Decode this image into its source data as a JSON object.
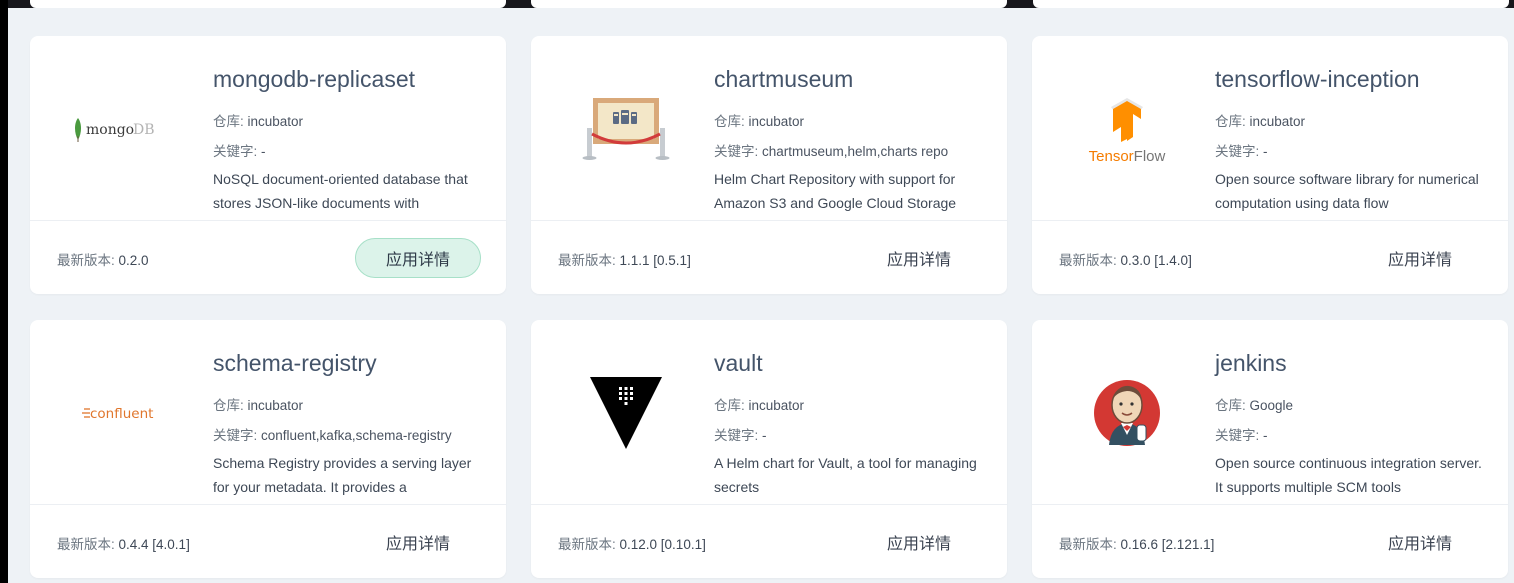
{
  "labels": {
    "repo": "仓库: ",
    "keywords": "关键字: ",
    "latest_version": "最新版本: ",
    "detail_button": "应用详情"
  },
  "cards": [
    {
      "title": "mongodb-replicaset",
      "repo": "incubator",
      "keywords": "-",
      "description": "NoSQL document-oriented database that stores JSON-like documents with",
      "version": "0.2.0",
      "logo": "mongodb-logo",
      "logo_text": "mongoDB",
      "button_active": true
    },
    {
      "title": "chartmuseum",
      "repo": "incubator",
      "keywords": "chartmuseum,helm,charts repo",
      "description": "Helm Chart Repository with support for Amazon S3 and Google Cloud Storage",
      "version": "1.1.1 [0.5.1]",
      "logo": "chartmuseum-logo",
      "button_active": false
    },
    {
      "title": "tensorflow-inception",
      "repo": "incubator",
      "keywords": "-",
      "description": "Open source software library for numerical computation using data flow",
      "version": "0.3.0 [1.4.0]",
      "logo": "tensorflow-logo",
      "logo_text": "TensorFlow",
      "button_active": false
    },
    {
      "title": "schema-registry",
      "repo": "incubator",
      "keywords": "confluent,kafka,schema-registry",
      "description": "Schema Registry provides a serving layer for your metadata. It provides a",
      "version": "0.4.4 [4.0.1]",
      "logo": "confluent-logo",
      "logo_text": "confluent",
      "button_active": false
    },
    {
      "title": "vault",
      "repo": "incubator",
      "keywords": "-",
      "description": "A Helm chart for Vault, a tool for managing secrets",
      "version": "0.12.0 [0.10.1]",
      "logo": "vault-logo",
      "button_active": false
    },
    {
      "title": "jenkins",
      "repo": "Google",
      "keywords": "-",
      "description": "Open source continuous integration server. It supports multiple SCM tools",
      "version": "0.16.6 [2.121.1]",
      "logo": "jenkins-logo",
      "button_active": false
    }
  ],
  "colors": {
    "page_bg": "#eef2f6",
    "card_bg": "#ffffff",
    "title": "#44546a",
    "button_active_bg": "#dcf3ea",
    "button_active_border": "#a7e0c8",
    "mongodb_green": "#4a9a3f",
    "tensorflow_orange": "#ff8f00",
    "confluent_orange": "#e0762c"
  }
}
